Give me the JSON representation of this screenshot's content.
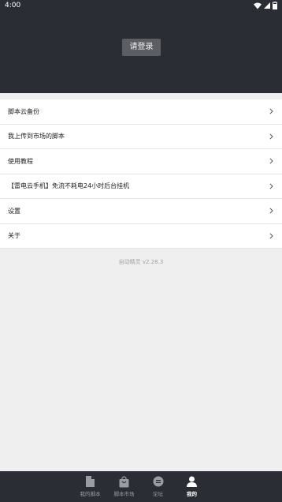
{
  "status_bar": {
    "time": "4:00"
  },
  "header": {
    "login_label": "请登录"
  },
  "menu": {
    "items": [
      {
        "label": "脚本云备份"
      },
      {
        "label": "我上传到市场的脚本"
      },
      {
        "label": "使用教程"
      },
      {
        "label": "【雷电云手机】免流不耗电24小时后台挂机"
      },
      {
        "label": "设置"
      },
      {
        "label": "关于"
      }
    ]
  },
  "version_text": "自动精灵 v2.28.3",
  "tabbar": {
    "tabs": [
      {
        "label": "我的脚本",
        "icon": "file-icon",
        "active": false
      },
      {
        "label": "脚本市场",
        "icon": "shopping-bag-icon",
        "active": false
      },
      {
        "label": "论坛",
        "icon": "chat-icon",
        "active": false
      },
      {
        "label": "我的",
        "icon": "person-icon",
        "active": true
      }
    ]
  },
  "colors": {
    "header_bg": "#2b2d35",
    "page_bg": "#efefef",
    "tab_active": "#ffffff",
    "tab_inactive": "#9a9ca2"
  }
}
